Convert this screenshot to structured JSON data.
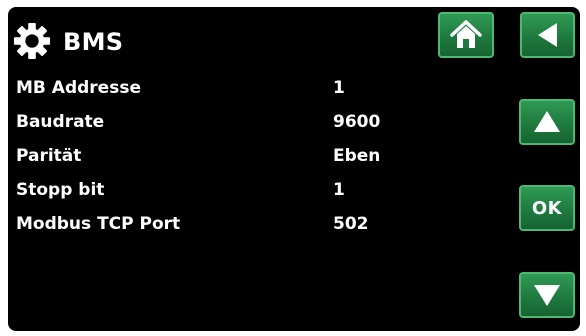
{
  "header": {
    "title": "BMS",
    "icon": "gear-icon"
  },
  "settings": [
    {
      "label": "MB Addresse",
      "value": "1"
    },
    {
      "label": "Baudrate",
      "value": "9600"
    },
    {
      "label": "Parität",
      "value": "Eben"
    },
    {
      "label": "Stopp bit",
      "value": "1"
    },
    {
      "label": "Modbus TCP Port",
      "value": "502"
    }
  ],
  "buttons": {
    "home_icon": "home-icon",
    "back_icon": "back-arrow-icon",
    "up_icon": "up-arrow-icon",
    "ok_label": "OK",
    "down_icon": "down-arrow-icon"
  },
  "colors": {
    "background": "#000000",
    "text": "#ffffff",
    "button_green": "#1f7a3e",
    "button_border": "#4db873"
  }
}
